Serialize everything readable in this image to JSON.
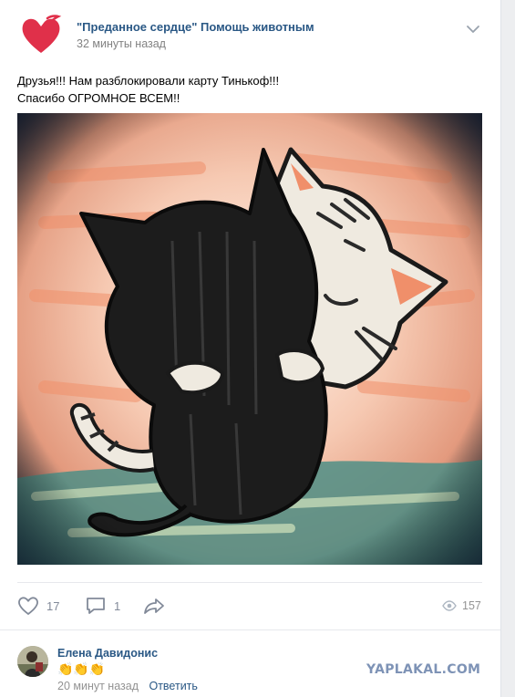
{
  "post": {
    "author": "\"Преданное сердце\" Помощь животным",
    "time": "32 минуты назад",
    "text_line1": "Друзья!!! Нам разблокировали карту Тинькоф!!!",
    "text_line2": "Спасибо ОГРОМНОЕ ВСЕМ!!",
    "likes": "17",
    "comments": "1",
    "views": "157"
  },
  "comment": {
    "author": "Елена Давидонис",
    "text": "👏👏👏",
    "time": "20 минут назад",
    "reply_label": "Ответить"
  },
  "watermark": "YAPLAKAL.COM",
  "colors": {
    "link": "#2a5885",
    "heart": "#e0304a",
    "meta": "#828282"
  }
}
